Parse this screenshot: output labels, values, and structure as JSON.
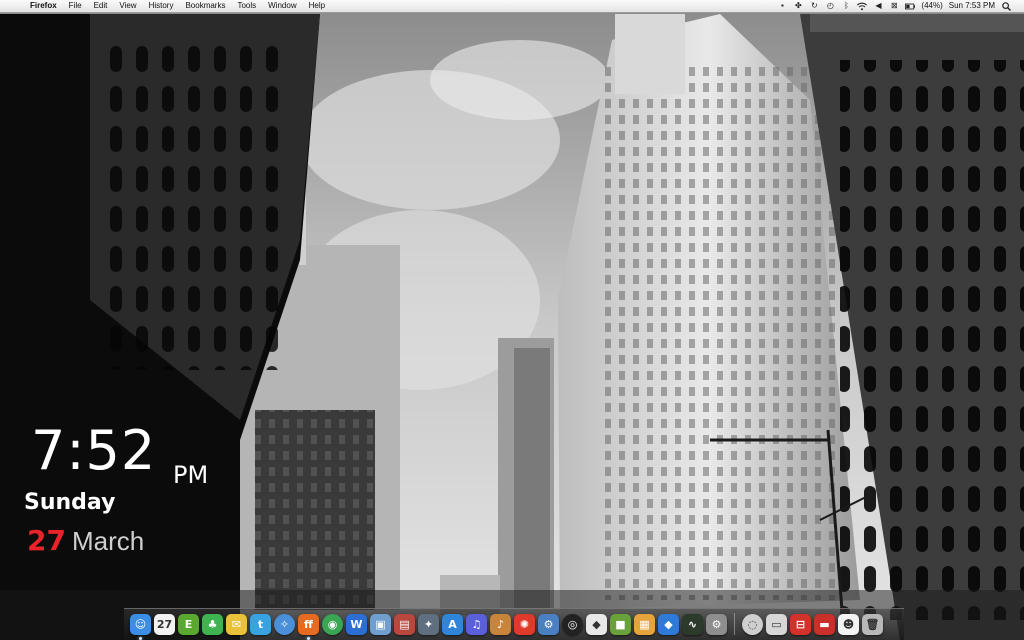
{
  "menubar": {
    "app_name": "Firefox",
    "items": [
      "File",
      "Edit",
      "View",
      "History",
      "Bookmarks",
      "Tools",
      "Window",
      "Help"
    ],
    "status": {
      "battery_text": "(44%)",
      "clock_text": "Sun 7:53 PM"
    }
  },
  "clock_widget": {
    "time": "7:52",
    "ampm": "PM",
    "weekday": "Sunday",
    "day_number": "27",
    "month": "March",
    "accent_color": "#e8232a"
  },
  "dock": {
    "apps": [
      {
        "name": "finder-icon",
        "glyph": "☺",
        "color": "#3a8ee6",
        "running": true
      },
      {
        "name": "ical-icon",
        "glyph": "27",
        "color": "#f2f2f2",
        "running": false
      },
      {
        "name": "evernote-icon",
        "glyph": "E",
        "color": "#5aa830",
        "running": false
      },
      {
        "name": "adium-icon",
        "glyph": "♣",
        "color": "#3fb34f",
        "running": false
      },
      {
        "name": "mail-bird-icon",
        "glyph": "✉",
        "color": "#e9c23a",
        "running": false
      },
      {
        "name": "twitter-icon",
        "glyph": "t",
        "color": "#38a3e0",
        "running": false
      },
      {
        "name": "safari-icon",
        "glyph": "✧",
        "color": "#4b8fd8",
        "running": false
      },
      {
        "name": "firefox-icon",
        "glyph": "ff",
        "color": "#e66a1f",
        "running": true
      },
      {
        "name": "chrome-icon",
        "glyph": "◉",
        "color": "#3aa552",
        "running": false
      },
      {
        "name": "word-icon",
        "glyph": "W",
        "color": "#2a6fd1",
        "running": false
      },
      {
        "name": "iphoto-icon",
        "glyph": "▣",
        "color": "#6f9ecf",
        "running": false
      },
      {
        "name": "photo-booth-icon",
        "glyph": "▤",
        "color": "#b9473e",
        "running": false
      },
      {
        "name": "misc-app-icon",
        "glyph": "✦",
        "color": "#5f6f7f",
        "running": false
      },
      {
        "name": "app-store-icon",
        "glyph": "A",
        "color": "#2f86d9",
        "running": false
      },
      {
        "name": "itunes-icon",
        "glyph": "♫",
        "color": "#5b5fd9",
        "running": false
      },
      {
        "name": "guitar-icon",
        "glyph": "♪",
        "color": "#c8843a",
        "running": false
      },
      {
        "name": "transmission-icon",
        "glyph": "✺",
        "color": "#e03a2a",
        "running": false
      },
      {
        "name": "utility-icon",
        "glyph": "⚙",
        "color": "#4a7fc1",
        "running": false
      },
      {
        "name": "dvd-player-icon",
        "glyph": "◎",
        "color": "#222222",
        "running": false
      },
      {
        "name": "cube-icon",
        "glyph": "◆",
        "color": "#e8e8e8",
        "running": false
      },
      {
        "name": "minecraft-icon",
        "glyph": "■",
        "color": "#6aa23a",
        "running": false
      },
      {
        "name": "box-icon",
        "glyph": "▦",
        "color": "#e7a43a",
        "running": false
      },
      {
        "name": "blue-cube-icon",
        "glyph": "◆",
        "color": "#2f7ad9",
        "running": false
      },
      {
        "name": "activity-monitor-icon",
        "glyph": "∿",
        "color": "#2c3a2c",
        "running": false
      },
      {
        "name": "system-preferences-icon",
        "glyph": "⚙",
        "color": "#8e8e8e",
        "running": false
      },
      {
        "name": "sep",
        "glyph": "",
        "color": "",
        "running": false
      },
      {
        "name": "disk-utility-icon",
        "glyph": "◌",
        "color": "#cfcfcf",
        "running": false
      },
      {
        "name": "imac-icon",
        "glyph": "▭",
        "color": "#d7d7d7",
        "running": false
      },
      {
        "name": "toolbox-icon",
        "glyph": "⊟",
        "color": "#d2322a",
        "running": false
      },
      {
        "name": "recorder-icon",
        "glyph": "▬",
        "color": "#c9302a",
        "running": false
      },
      {
        "name": "stormtrooper-icon",
        "glyph": "☻",
        "color": "#f4f4f4",
        "running": false
      },
      {
        "name": "trash-icon",
        "glyph": "🗑",
        "color": "#b8b8b8",
        "running": false
      }
    ]
  }
}
